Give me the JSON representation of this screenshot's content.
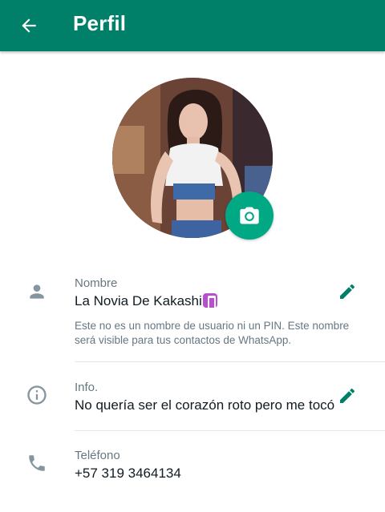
{
  "appbar": {
    "title": "Perfil",
    "color": "#008069",
    "back_icon": "arrow-back-icon"
  },
  "profile": {
    "camera_icon": "camera-icon",
    "accent": "#00a884"
  },
  "name_section": {
    "icon": "person-icon",
    "label": "Nombre",
    "value": "La Novia De Kakashi",
    "hint": "Este no es un nombre de usuario ni un PIN. Este nombre será visible para tus contactos de WhatsApp.",
    "edit_icon": "pencil-icon"
  },
  "info_section": {
    "icon": "info-icon",
    "label": "Info.",
    "value": "No quería ser el corazón roto pero me tocó",
    "edit_icon": "pencil-icon"
  },
  "phone_section": {
    "icon": "phone-icon",
    "label": "Teléfono",
    "value": "+57 319 3464134"
  }
}
